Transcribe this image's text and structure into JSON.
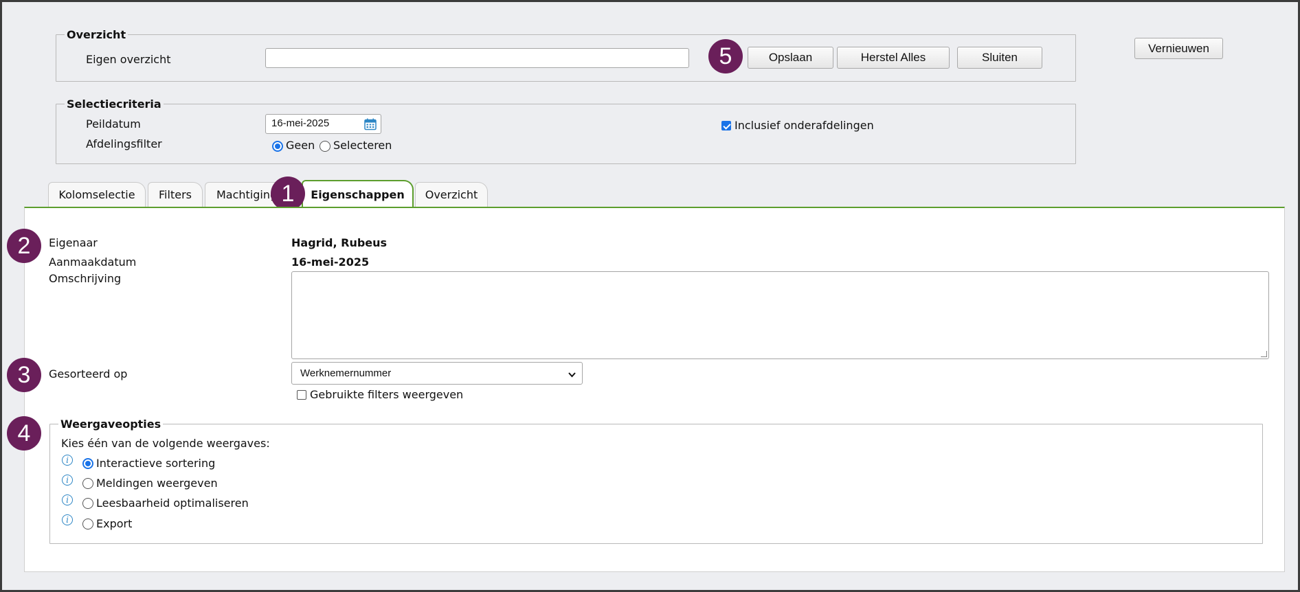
{
  "overzicht": {
    "legend": "Overzicht",
    "eigen_label": "Eigen overzicht",
    "eigen_value": "",
    "buttons": {
      "opslaan": "Opslaan",
      "herstel": "Herstel Alles",
      "sluiten": "Sluiten"
    }
  },
  "vernieuwen": "Vernieuwen",
  "selectiecriteria": {
    "legend": "Selectiecriteria",
    "peildatum_label": "Peildatum",
    "peildatum_value": "16-mei-2025",
    "afdelingsfilter_label": "Afdelingsfilter",
    "radio_geen": "Geen",
    "radio_selecteren": "Selecteren",
    "inclusief_label": "Inclusief onderafdelingen",
    "inclusief_checked": true
  },
  "tabs": [
    {
      "label": "Kolomselectie"
    },
    {
      "label": "Filters"
    },
    {
      "label": "Machtiging"
    },
    {
      "label": "Eigenschappen",
      "active": true
    },
    {
      "label": "Overzicht"
    }
  ],
  "eigenschappen": {
    "eigenaar_label": "Eigenaar",
    "eigenaar_value": "Hagrid, Rubeus",
    "aanmaakdatum_label": "Aanmaakdatum",
    "aanmaakdatum_value": "16-mei-2025",
    "omschrijving_label": "Omschrijving",
    "omschrijving_value": "",
    "gesorteerd_label": "Gesorteerd op",
    "gesorteerd_value": "Werknemernummer",
    "gebruikte_filters_label": "Gebruikte filters weergeven"
  },
  "weergaveopties": {
    "legend": "Weergaveopties",
    "intro": "Kies één van de volgende weergaves:",
    "options": [
      {
        "label": "Interactieve sortering",
        "selected": true
      },
      {
        "label": "Meldingen weergeven"
      },
      {
        "label": "Leesbaarheid optimaliseren"
      },
      {
        "label": "Export"
      }
    ]
  },
  "badges": [
    "1",
    "2",
    "3",
    "4",
    "5"
  ],
  "colors": {
    "badge": "#6a1f5a",
    "tab_accent": "#5c9e2d",
    "radio_accent": "#1a73e8",
    "info_icon": "#2d86c5"
  }
}
